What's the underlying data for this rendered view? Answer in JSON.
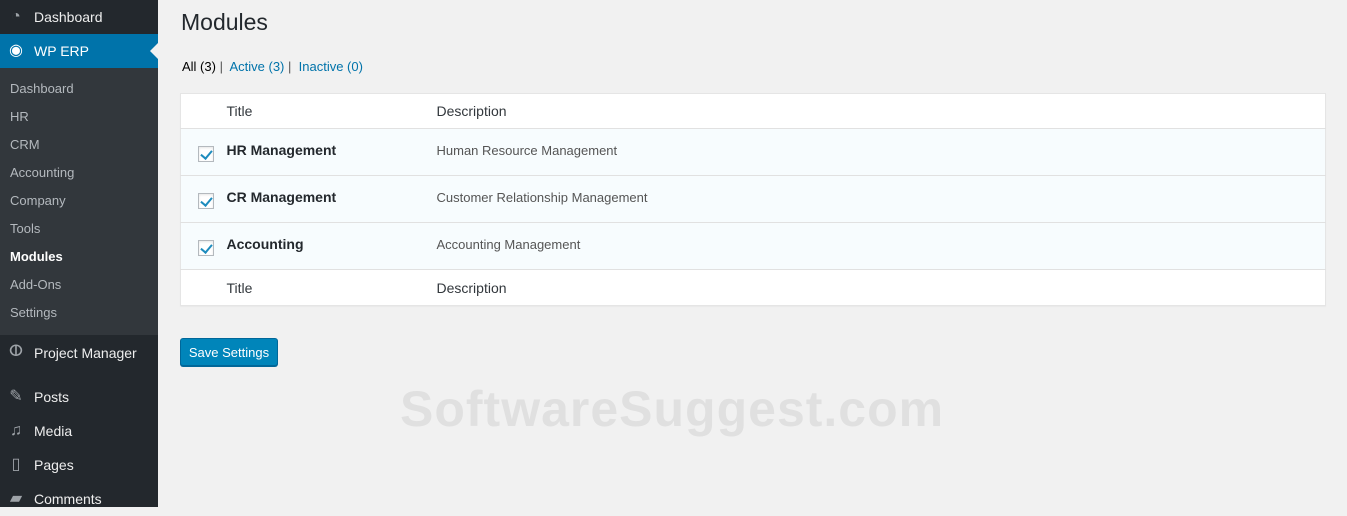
{
  "sidebar": {
    "dashboard": "Dashboard",
    "wperp": "WP ERP",
    "submenu": [
      "Dashboard",
      "HR",
      "CRM",
      "Accounting",
      "Company",
      "Tools",
      "Modules",
      "Add-Ons",
      "Settings"
    ],
    "project_manager": "Project Manager",
    "posts": "Posts",
    "media": "Media",
    "pages": "Pages",
    "comments": "Comments"
  },
  "page": {
    "title": "Modules",
    "filters": {
      "all": "All (3)",
      "active": "Active (3)",
      "inactive": "Inactive (0)",
      "sep": "|"
    },
    "columns": {
      "title": "Title",
      "description": "Description"
    },
    "rows": [
      {
        "title": "HR Management",
        "description": "Human Resource Management",
        "checked": true
      },
      {
        "title": "CR Management",
        "description": "Customer Relationship Management",
        "checked": true
      },
      {
        "title": "Accounting",
        "description": "Accounting Management",
        "checked": true
      }
    ],
    "save_label": "Save Settings"
  },
  "watermark": "SoftwareSuggest.com",
  "colors": {
    "accent": "#0073aa",
    "sidebar": "#23282d",
    "button": "#0085ba"
  }
}
